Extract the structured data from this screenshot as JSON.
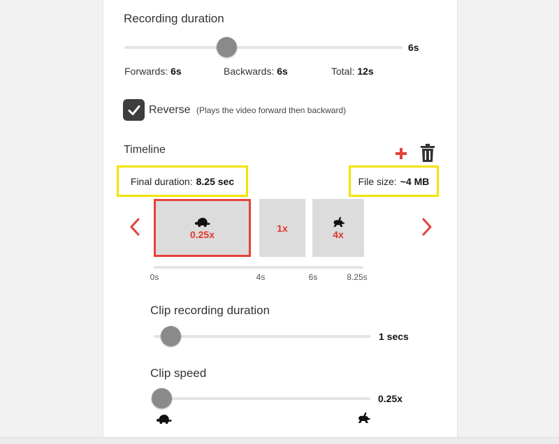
{
  "recording": {
    "title": "Recording duration",
    "slider_value_label": "6s",
    "slider_fraction": 0.37,
    "stats": {
      "forwards_label": "Forwards:",
      "forwards_value": "6s",
      "backwards_label": "Backwards:",
      "backwards_value": "6s",
      "total_label": "Total:",
      "total_value": "12s"
    }
  },
  "reverse": {
    "checked": true,
    "label": "Reverse",
    "hint": "(Plays the video forward then backward)"
  },
  "timeline": {
    "title": "Timeline",
    "add_icon": "plus-icon",
    "delete_icon": "trash-icon",
    "final_duration_label": "Final duration:",
    "final_duration_value": "8.25 sec",
    "file_size_label": "File size:",
    "file_size_value": "~4 MB",
    "prev_icon": "chevron-left-icon",
    "next_icon": "chevron-right-icon",
    "clips": [
      {
        "speed": "0.25x",
        "icon": "turtle-icon",
        "selected": true
      },
      {
        "speed": "1x",
        "icon": "",
        "selected": false
      },
      {
        "speed": "4x",
        "icon": "rabbit-icon",
        "selected": false
      }
    ],
    "ticks": [
      "0s",
      "4s",
      "6s",
      "8.25s"
    ]
  },
  "clip_duration": {
    "title": "Clip recording duration",
    "value_label": "1 secs",
    "slider_fraction": 0.0
  },
  "clip_speed": {
    "title": "Clip speed",
    "value_label": "0.25x",
    "slider_fraction": 0.0,
    "min_icon": "turtle-icon",
    "max_icon": "rabbit-icon"
  },
  "colors": {
    "accent": "#e5413a",
    "highlight": "#f2e400",
    "thumb": "#8a8a8a",
    "clip_bg": "#dcdcdc"
  }
}
